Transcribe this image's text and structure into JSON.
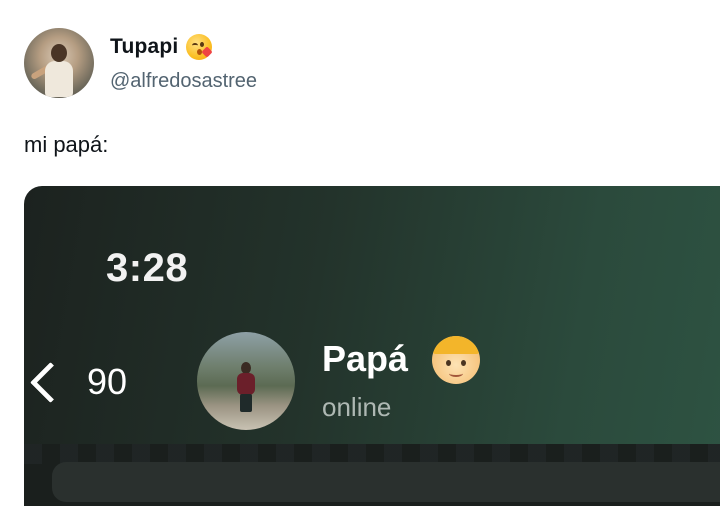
{
  "tweet": {
    "author": {
      "display_name": "Tupapi",
      "name_emoji": "kissing-face-with-heart-icon",
      "handle": "@alfredosastree"
    },
    "text": "mi papá:"
  },
  "screenshot": {
    "clock": "3:28",
    "chat": {
      "back_count": "90",
      "contact_name": "Papá",
      "contact_emoji": "man-blond-hair-icon",
      "status": "online"
    }
  },
  "colors": {
    "chat_header_bg": "#2b4a3c",
    "handle_gray": "#536471",
    "status_gray": "#aeb8b3"
  }
}
